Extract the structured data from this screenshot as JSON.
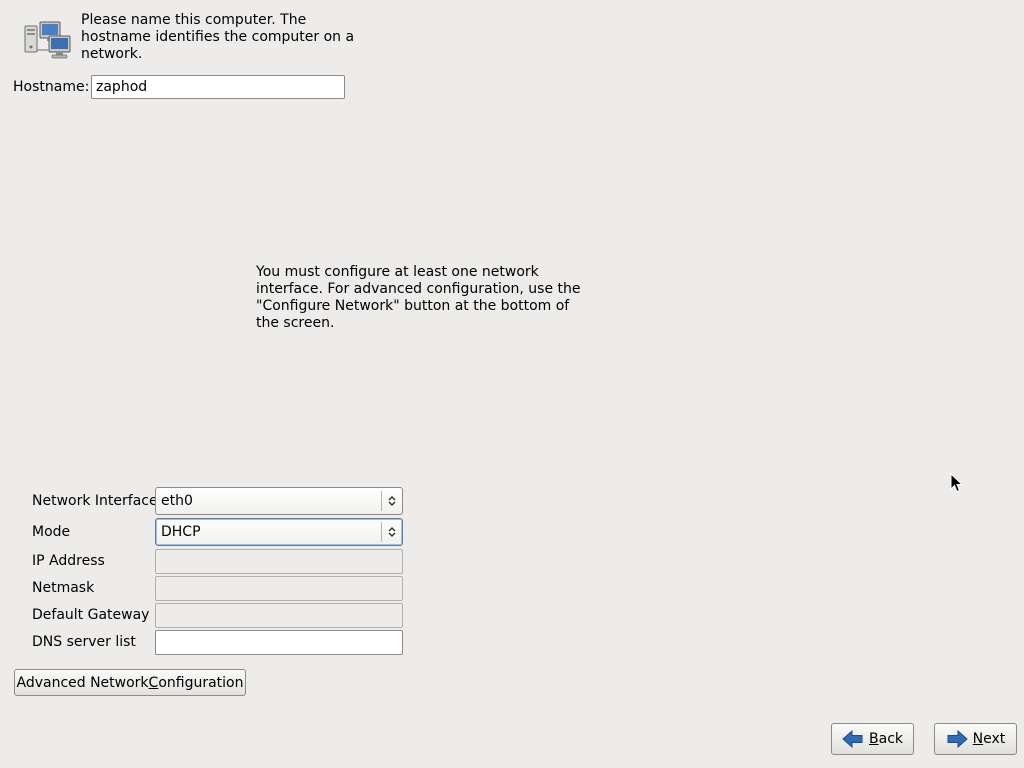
{
  "hostname_section": {
    "intro_text": "Please name this computer.  The hostname identifies the computer on a network.",
    "label": "Hostname:",
    "value": "zaphod"
  },
  "network_info_text": "You must configure at least one network interface.  For advanced configuration, use the \"Configure Network\" button at the bottom of the screen.",
  "network_form": {
    "interface": {
      "label": "Network Interface",
      "value": "eth0"
    },
    "mode": {
      "label": "Mode",
      "value": "DHCP"
    },
    "ip_address": {
      "label": "IP Address",
      "value": ""
    },
    "netmask": {
      "label": "Netmask",
      "value": ""
    },
    "default_gateway": {
      "label": "Default Gateway",
      "value": ""
    },
    "dns_server_list": {
      "label": "DNS server list",
      "value": ""
    }
  },
  "buttons": {
    "advanced": {
      "pre": "Advanced Network ",
      "mnemonic": "C",
      "post": "onfiguration"
    },
    "back": {
      "mnemonic": "B",
      "post": "ack"
    },
    "next": {
      "mnemonic": "N",
      "post": "ext"
    }
  },
  "icons": {
    "computer": "network-computers-icon",
    "back": "back-arrow-icon",
    "next": "next-arrow-icon",
    "combo": "up-down-chevron-icon"
  },
  "colors": {
    "background": "#edeceb",
    "arrow_blue": "#2e6db6",
    "focus_border": "#5b7fa8"
  }
}
